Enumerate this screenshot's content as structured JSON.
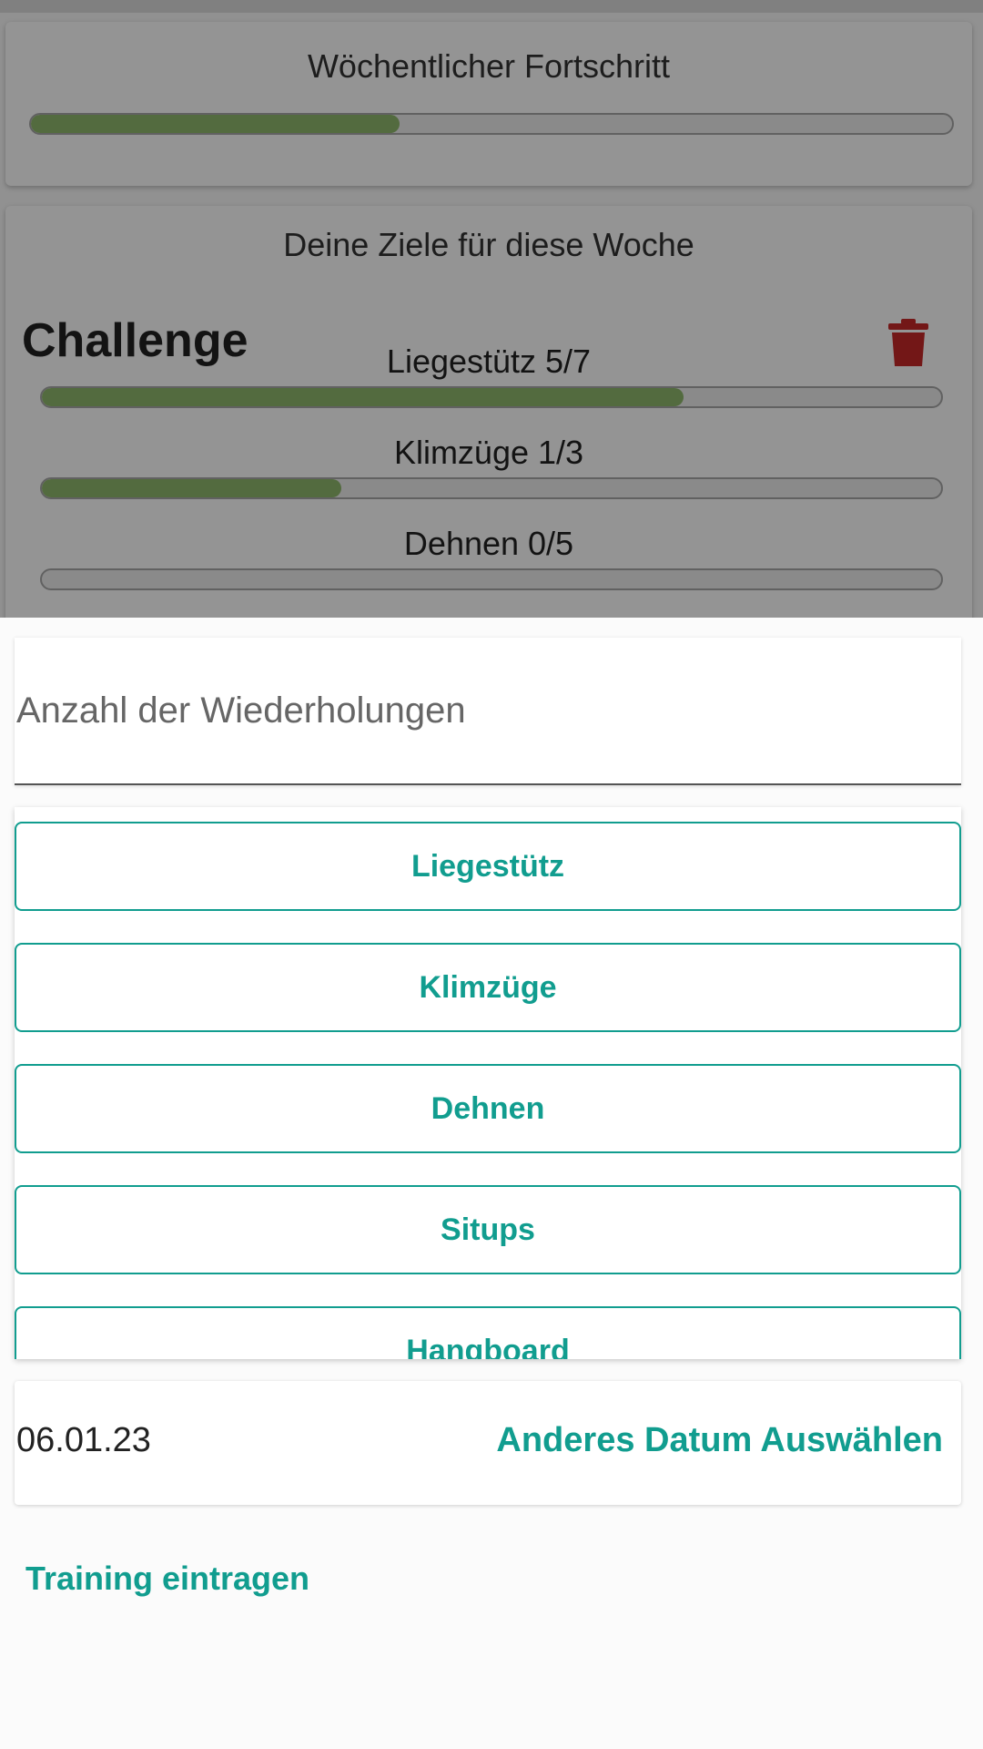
{
  "weekly_progress": {
    "title": "Wöchentlicher Fortschritt",
    "progress": 0.4
  },
  "goals": {
    "title": "Deine Ziele für diese Woche",
    "challenge": {
      "title": "Challenge",
      "delete_icon": "trash-icon",
      "items": [
        {
          "label": "Liegestütz 5/7",
          "progress": 0.714
        },
        {
          "label": "Klimzüge 1/3",
          "progress": 0.333
        },
        {
          "label": "Dehnen 0/5",
          "progress": 0
        }
      ]
    }
  },
  "form": {
    "reps_placeholder": "Anzahl der Wiederholungen",
    "exercises": [
      "Liegestütz",
      "Klimzüge",
      "Dehnen",
      "Situps",
      "Hangboard"
    ],
    "date": "06.01.23",
    "change_date_label": "Anderes Datum Auswählen",
    "submit_label": "Training eintragen"
  },
  "colors": {
    "accent": "#119d8f",
    "progress_fill": "#8fb86d",
    "delete": "#c62828"
  }
}
